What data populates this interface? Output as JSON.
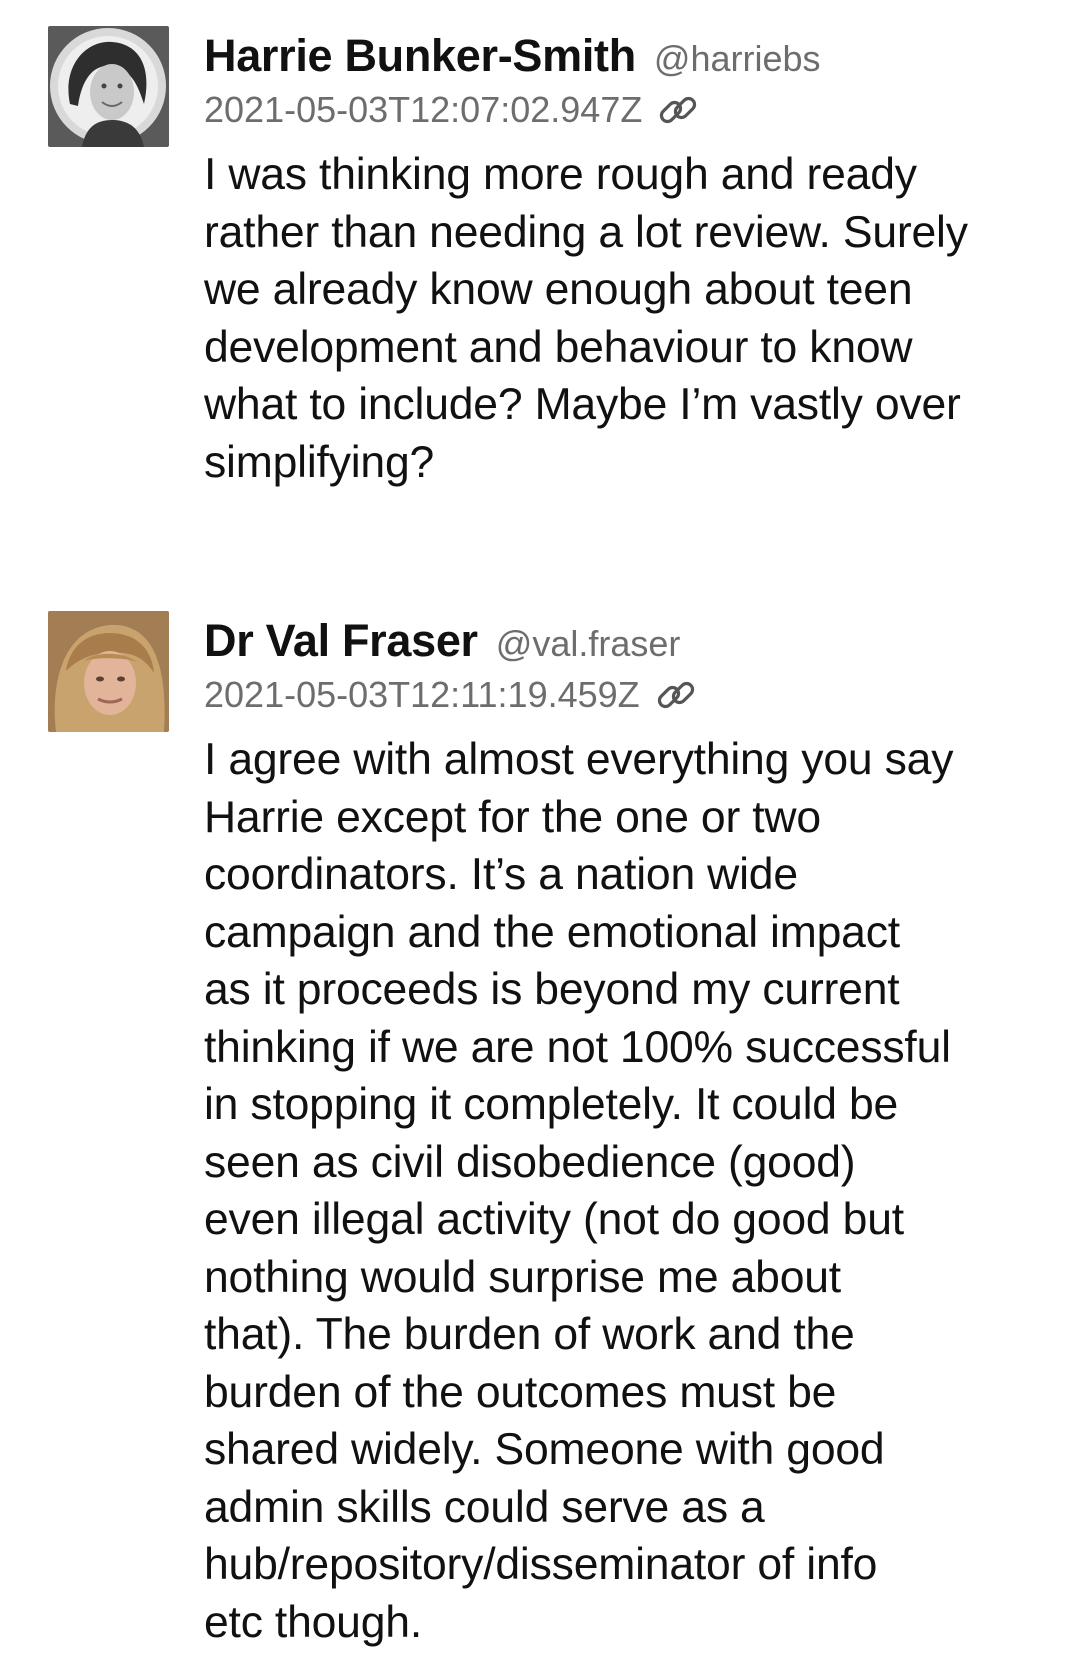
{
  "messages": [
    {
      "author": "Harrie Bunker-Smith",
      "handle": "@harriebs",
      "timestamp": "2021-05-03T12:07:02.947Z",
      "permalink_icon": "link-icon",
      "avatar_icon": "avatar-woman-dark-hair",
      "body_lines": [
        "I was thinking more rough and ready",
        "rather than needing a lot review. Surely",
        "we already know enough about teen",
        "development and behaviour to know",
        "what to include? Maybe I’m vastly over",
        "simplifying?"
      ]
    },
    {
      "author": "Dr Val Fraser",
      "handle": "@val.fraser",
      "timestamp": "2021-05-03T12:11:19.459Z",
      "permalink_icon": "link-icon",
      "avatar_icon": "avatar-woman-blonde-hair",
      "body_lines": [
        "I agree with almost everything you say",
        "Harrie except for the one or two",
        "coordinators. It’s a nation wide",
        "campaign and the emotional impact",
        "as it proceeds is beyond my current",
        "thinking if we are not 100% successful",
        "in stopping it completely. It could be",
        "seen as civil disobedience (good)",
        "even illegal activity (not do good but",
        "nothing would surprise me about",
        "that). The burden of work and the",
        "burden of the outcomes must be",
        "shared widely. Someone with good",
        "admin skills could serve as a",
        "hub/repository/disseminator of info",
        "etc though."
      ]
    }
  ],
  "colors": {
    "text": "#111111",
    "muted": "#6d6d6d",
    "background": "#ffffff"
  }
}
